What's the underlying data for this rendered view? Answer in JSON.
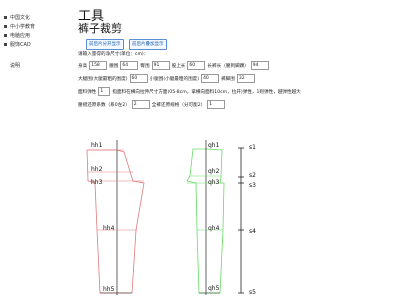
{
  "sidebar": {
    "items": [
      {
        "label": "中国文化"
      },
      {
        "label": "中小学教育"
      },
      {
        "label": "电脑应用"
      },
      {
        "label": "服饰CAD"
      },
      {
        "label": "说明"
      }
    ]
  },
  "page": {
    "title": "工具",
    "subtitle": "裤子裁剪"
  },
  "buttons": {
    "show_front": "前后片分开显示",
    "show_overlay": "前后片叠加显示"
  },
  "form": {
    "intro": "请输入量得的净尺寸(单位：cm)：",
    "row1": {
      "height_label": "身高",
      "height_value": "158",
      "waist_label": "腰围",
      "waist_value": "64",
      "hip_label": "臀围",
      "hip_value": "91",
      "crotch_label": "股上长",
      "crotch_value": "60",
      "length_label": "长裤长（腰到脚踝）",
      "length_value": "94"
    },
    "row2": {
      "thigh_label": "大腿围(大腿最粗的围度)",
      "thigh_value": "60",
      "calf_label": "小腿围(小腿最粗的围度)",
      "calf_value": "40",
      "hem_label": "裤脚围",
      "hem_value": "32"
    },
    "row3": {
      "stretch_label": "面料弹性",
      "stretch_value": "1",
      "stretch_note": "指面料在横向拉伸尺寸方面(05-8cm，拿横向面料10cm，拉开)弹性，1则弹性，越弹性越大"
    },
    "row4": {
      "waist_ease_label": "腰褶还原系数（系0左2）",
      "waist_ease_value": "2",
      "hip_ease_label": "全裤还原规格（分可能2）",
      "hip_ease_value": "1"
    }
  },
  "pattern": {
    "front_labels": [
      "hh1",
      "hh2",
      "hh3",
      "hh4",
      "hh5"
    ],
    "back_labels": [
      "qh1",
      "qh2",
      "qh3",
      "qh4",
      "qh5"
    ],
    "scale_labels": [
      "s1",
      "s2",
      "s3",
      "s4",
      "s5"
    ],
    "front_color": "#e07a7a",
    "back_color": "#66dd66",
    "axis_color": "#222222"
  }
}
